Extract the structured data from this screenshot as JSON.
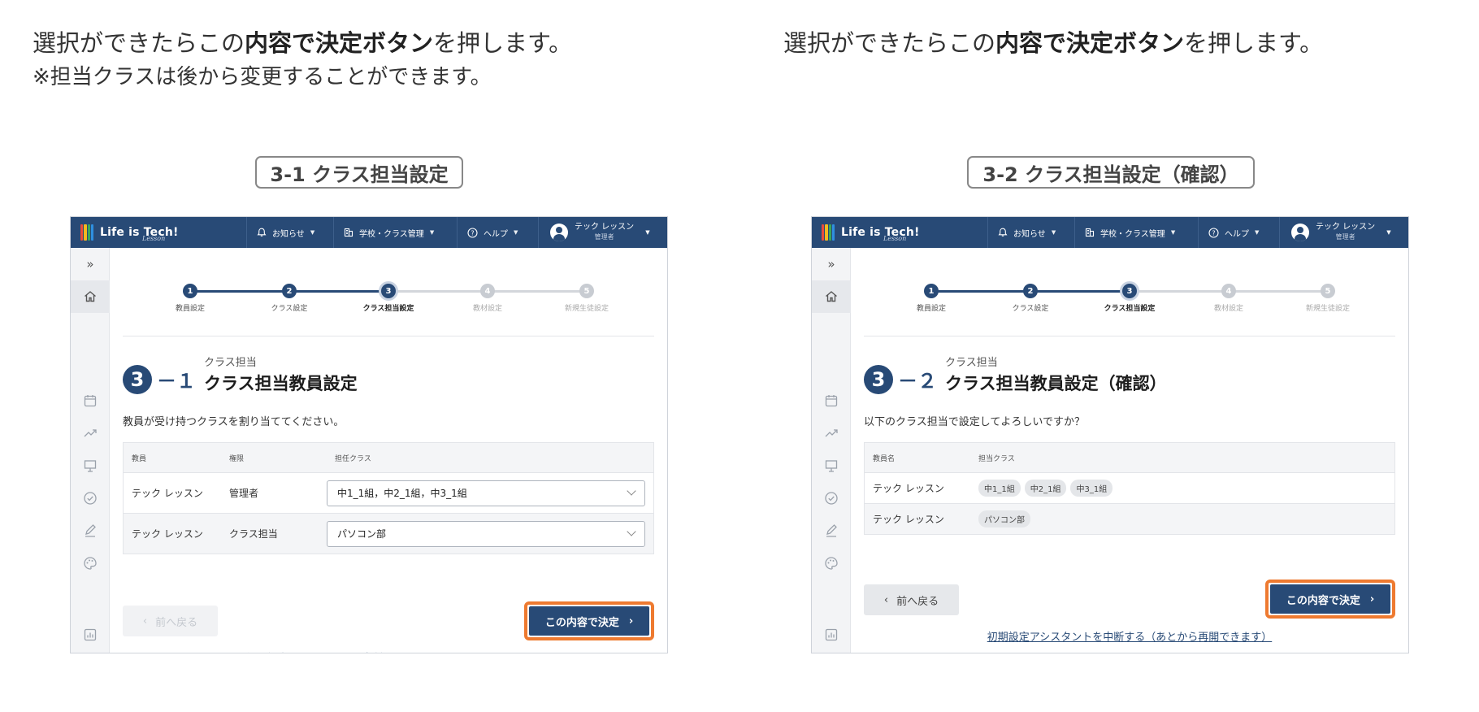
{
  "intro_left": {
    "line1_pre": "選択ができたらこの",
    "line1_bold": "内容で決定ボタン",
    "line1_post": "を押します。",
    "line2": "※担当クラスは後から変更することができます。"
  },
  "intro_right": {
    "line1_pre": "選択ができたらこの",
    "line1_bold": "内容で決定ボタン",
    "line1_post": "を押します。"
  },
  "caption_left": "3-1 クラス担当設定",
  "caption_right": "3-2 クラス担当設定（確認）",
  "app": {
    "logo_text": "Life is Tech!",
    "logo_sub": "Lesson",
    "nav_notice": "お知らせ",
    "nav_school": "学校・クラス管理",
    "nav_help": "ヘルプ",
    "user_name": "テック レッスン",
    "user_role": "管理者",
    "colors": {
      "header": "#284a76",
      "accent": "#ee7a30",
      "step_active": "#284a76",
      "step_inactive": "#c8ccd2"
    },
    "steps": [
      {
        "num": "1",
        "label": "教員設定"
      },
      {
        "num": "2",
        "label": "クラス設定"
      },
      {
        "num": "3",
        "label": "クラス担当設定"
      },
      {
        "num": "4",
        "label": "教材設定"
      },
      {
        "num": "5",
        "label": "新規生徒設定"
      }
    ],
    "abort_link": "初期設定アシスタントを中断する（あとから再開できます）"
  },
  "panel_left": {
    "big_num": "3",
    "sub_num": "－１",
    "title_small": "クラス担当",
    "title_main": "クラス担当教員設定",
    "description": "教員が受け持つクラスを割り当ててください。",
    "headers": [
      "教員",
      "権限",
      "担任クラス"
    ],
    "rows": [
      {
        "teacher": "テック レッスン",
        "role": "管理者",
        "classes": "中1_1組，中2_1組，中3_1組"
      },
      {
        "teacher": "テック レッスン",
        "role": "クラス担当",
        "classes": "パソコン部"
      }
    ],
    "back_label": "前へ戻る",
    "ok_label": "この内容で決定"
  },
  "panel_right": {
    "big_num": "3",
    "sub_num": "－２",
    "title_small": "クラス担当",
    "title_main": "クラス担当教員設定（確認）",
    "description": "以下のクラス担当で設定してよろしいですか？",
    "headers": [
      "教員名",
      "担当クラス"
    ],
    "rows": [
      {
        "teacher": "テック レッスン",
        "chips": [
          "中1_1組",
          "中2_1組",
          "中3_1組"
        ]
      },
      {
        "teacher": "テック レッスン",
        "chips": [
          "パソコン部"
        ]
      }
    ],
    "back_label": "前へ戻る",
    "ok_label": "この内容で決定"
  }
}
